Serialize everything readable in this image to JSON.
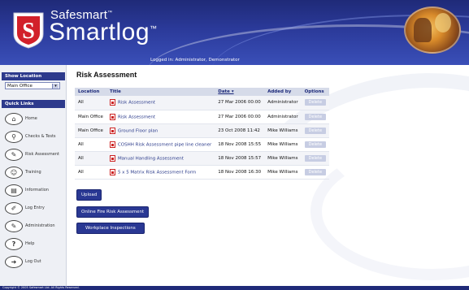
{
  "header": {
    "brand_top": "Safesmart",
    "brand_top_tm": "™",
    "brand_main": "Smartlog",
    "brand_main_tm": "™",
    "logged_in": "Logged in: Administrator, Demonstrator",
    "logo_letter": "S"
  },
  "sidebar": {
    "show_location_label": "Show Location",
    "location_value": "Main Office",
    "quick_links_label": "Quick Links",
    "items": [
      {
        "label": "Home",
        "icon": "home-icon",
        "glyph": "⌂"
      },
      {
        "label": "Checks & Tests",
        "icon": "magnifier-icon",
        "glyph": "⚲"
      },
      {
        "label": "Risk Assessment",
        "icon": "pen-icon",
        "glyph": "✎"
      },
      {
        "label": "Training",
        "icon": "people-icon",
        "glyph": "☺"
      },
      {
        "label": "Information",
        "icon": "book-icon",
        "glyph": "▤"
      },
      {
        "label": "Log Entry",
        "icon": "pencil-icon",
        "glyph": "✐"
      },
      {
        "label": "Administration",
        "icon": "wrench-icon",
        "glyph": "✎"
      },
      {
        "label": "Help",
        "icon": "question-icon",
        "glyph": "?"
      },
      {
        "label": "Log Out",
        "icon": "logout-icon",
        "glyph": "➜"
      }
    ]
  },
  "main": {
    "title": "Risk Assessment",
    "columns": {
      "location": "Location",
      "title": "Title",
      "date": "Date ▾",
      "added_by": "Added by",
      "options": "Options"
    },
    "rows": [
      {
        "location": "All",
        "title": "Risk Assessment",
        "date": "27 Mar 2006 00:00",
        "added_by": "Administrator",
        "option": "Delete"
      },
      {
        "location": "Main Office",
        "title": "Risk Assessment",
        "date": "27 Mar 2006 00:00",
        "added_by": "Administrator",
        "option": "Delete"
      },
      {
        "location": "Main Office",
        "title": "Ground Floor plan",
        "date": "23 Oct 2008 11:42",
        "added_by": "Mike Williams",
        "option": "Delete"
      },
      {
        "location": "All",
        "title": "COSHH Risk Assessment pipe line cleaner",
        "date": "18 Nov 2008 15:55",
        "added_by": "Mike Williams",
        "option": "Delete"
      },
      {
        "location": "All",
        "title": "Manual Handling Assessment",
        "date": "18 Nov 2008 15:57",
        "added_by": "Mike Williams",
        "option": "Delete"
      },
      {
        "location": "All",
        "title": "5 x 5 Matrix Risk Assessment Form",
        "date": "18 Nov 2008 16:30",
        "added_by": "Mike Williams",
        "option": "Delete"
      }
    ],
    "upload_label": "Upload",
    "online_fire_label": "Online Fire Risk Assessment",
    "workplace_label": "Workplace Inspections"
  },
  "footer": {
    "copyright": "Copyright © 2005 Safesmart Ltd. All Rights Reserved."
  }
}
